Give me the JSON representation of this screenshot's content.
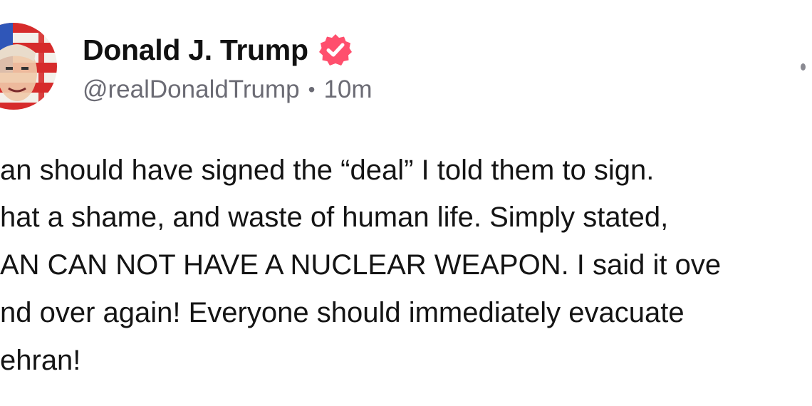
{
  "post": {
    "author": {
      "display_name": "Donald J. Trump",
      "handle": "@realDonaldTrump",
      "separator": "•",
      "time": "10m",
      "verified_icon": "verified-badge-icon",
      "verified_color": "#ff4f6d"
    },
    "menu_icon": "more-options-icon",
    "body_lines": [
      "an should have signed the “deal” I told them to sign.",
      "hat a shame, and waste of human life. Simply stated,",
      "AN CAN NOT HAVE A NUCLEAR WEAPON. I said it ove",
      "nd over again! Everyone should immediately evacuate",
      "ehran!"
    ]
  }
}
